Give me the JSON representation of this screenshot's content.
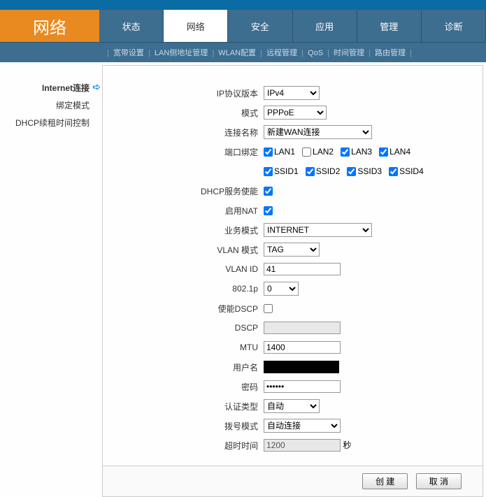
{
  "logo": "网络",
  "tabs": [
    "状态",
    "网络",
    "安全",
    "应用",
    "管理",
    "诊断"
  ],
  "activeTab": 1,
  "subnav": [
    "宽带设置",
    "LAN侧地址管理",
    "WLAN配置",
    "远程管理",
    "QoS",
    "时间管理",
    "路由管理"
  ],
  "sidebar": {
    "items": [
      "Internet连接",
      "绑定模式",
      "DHCP续租时间控制"
    ],
    "activeIndex": 0
  },
  "form": {
    "ipver_label": "IP协议版本",
    "ipver_value": "IPv4",
    "mode_label": "模式",
    "mode_value": "PPPoE",
    "conn_label": "连接名称",
    "conn_value": "新建WAN连接",
    "bind_label": "端口绑定",
    "bind_row1": [
      {
        "label": "LAN1",
        "checked": true
      },
      {
        "label": "LAN2",
        "checked": false
      },
      {
        "label": "LAN3",
        "checked": true
      },
      {
        "label": "LAN4",
        "checked": true
      }
    ],
    "bind_row2": [
      {
        "label": "SSID1",
        "checked": true
      },
      {
        "label": "SSID2",
        "checked": true
      },
      {
        "label": "SSID3",
        "checked": true
      },
      {
        "label": "SSID4",
        "checked": true
      }
    ],
    "dhcp_label": "DHCP服务使能",
    "dhcp_checked": true,
    "nat_label": "启用NAT",
    "nat_checked": true,
    "svc_label": "业务模式",
    "svc_value": "INTERNET",
    "vlanmode_label": "VLAN 模式",
    "vlanmode_value": "TAG",
    "vlanid_label": "VLAN ID",
    "vlanid_value": "41",
    "p8021_label": "802.1p",
    "p8021_value": "0",
    "dscp_en_label": "使能DSCP",
    "dscp_en_checked": false,
    "dscp_label": "DSCP",
    "dscp_value": "",
    "mtu_label": "MTU",
    "mtu_value": "1400",
    "user_label": "用户名",
    "pass_label": "密码",
    "pass_value": "••••••",
    "auth_label": "认证类型",
    "auth_value": "自动",
    "dial_label": "拨号模式",
    "dial_value": "自动连接",
    "timeout_label": "超时时间",
    "timeout_value": "1200",
    "timeout_unit": "秒"
  },
  "buttons": {
    "create": "创 建",
    "cancel": "取 消"
  }
}
